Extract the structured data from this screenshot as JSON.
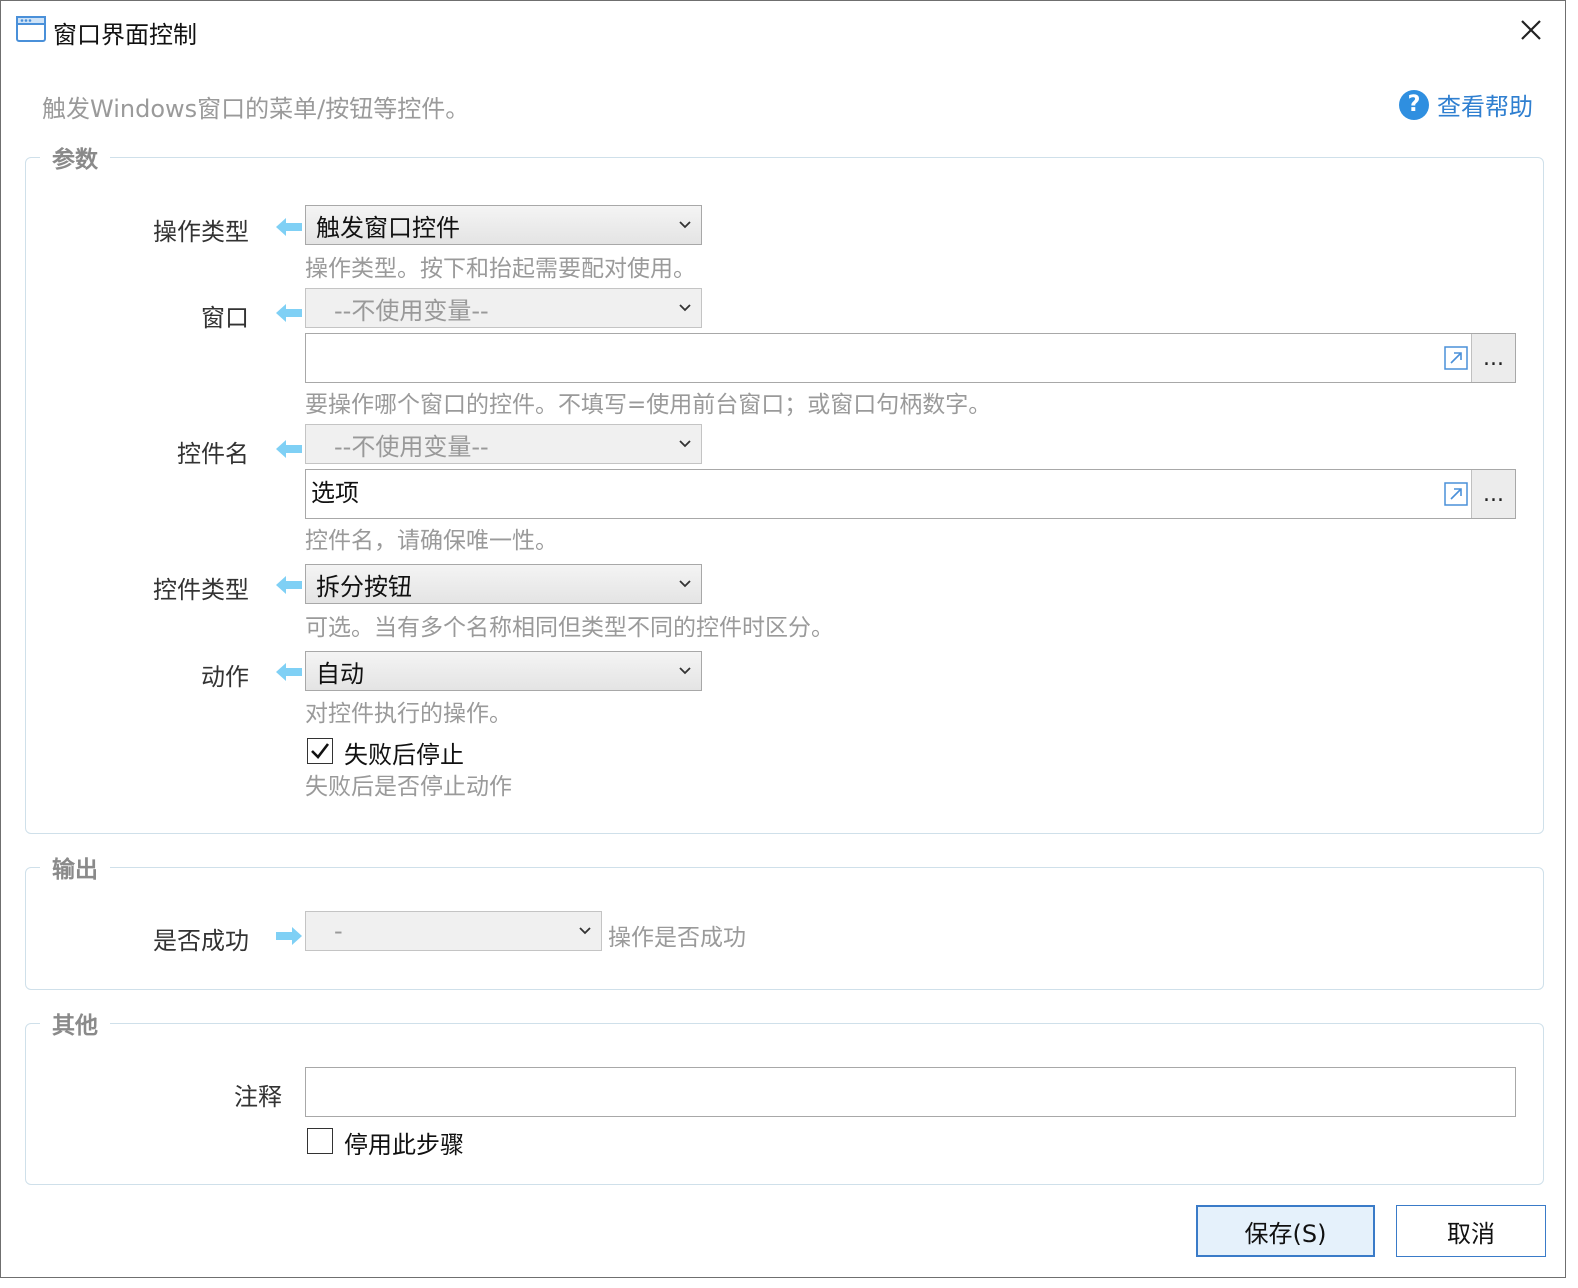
{
  "window": {
    "title": "窗口界面控制",
    "description": "触发Windows窗口的菜单/按钮等控件。",
    "help_label": "查看帮助"
  },
  "colors": {
    "accent": "#3a7bc8",
    "arrow": "#7fd0f5",
    "help": "#2f8fe0"
  },
  "params": {
    "group_title": "参数",
    "op_type": {
      "label": "操作类型",
      "value": "触发窗口控件",
      "hint": "操作类型。按下和抬起需要配对使用。"
    },
    "window": {
      "label": "窗口",
      "var_value": "--不使用变量--",
      "text": "",
      "more": "...",
      "hint": "要操作哪个窗口的控件。不填写=使用前台窗口；或窗口句柄数字。"
    },
    "control_name": {
      "label": "控件名",
      "var_value": "--不使用变量--",
      "text": "选项",
      "more": "...",
      "hint": "控件名，请确保唯一性。"
    },
    "control_type": {
      "label": "控件类型",
      "value": "拆分按钮",
      "hint": "可选。当有多个名称相同但类型不同的控件时区分。"
    },
    "action": {
      "label": "动作",
      "value": "自动",
      "hint": "对控件执行的操作。"
    },
    "stop_on_fail": {
      "label": "失败后停止",
      "checked": true,
      "hint": "失败后是否停止动作"
    }
  },
  "output": {
    "group_title": "输出",
    "success": {
      "label": "是否成功",
      "value": "-",
      "hint": "操作是否成功"
    }
  },
  "other": {
    "group_title": "其他",
    "comment": {
      "label": "注释",
      "value": ""
    },
    "disable_step": {
      "label": "停用此步骤",
      "checked": false
    }
  },
  "buttons": {
    "save": "保存(S)",
    "cancel": "取消"
  }
}
